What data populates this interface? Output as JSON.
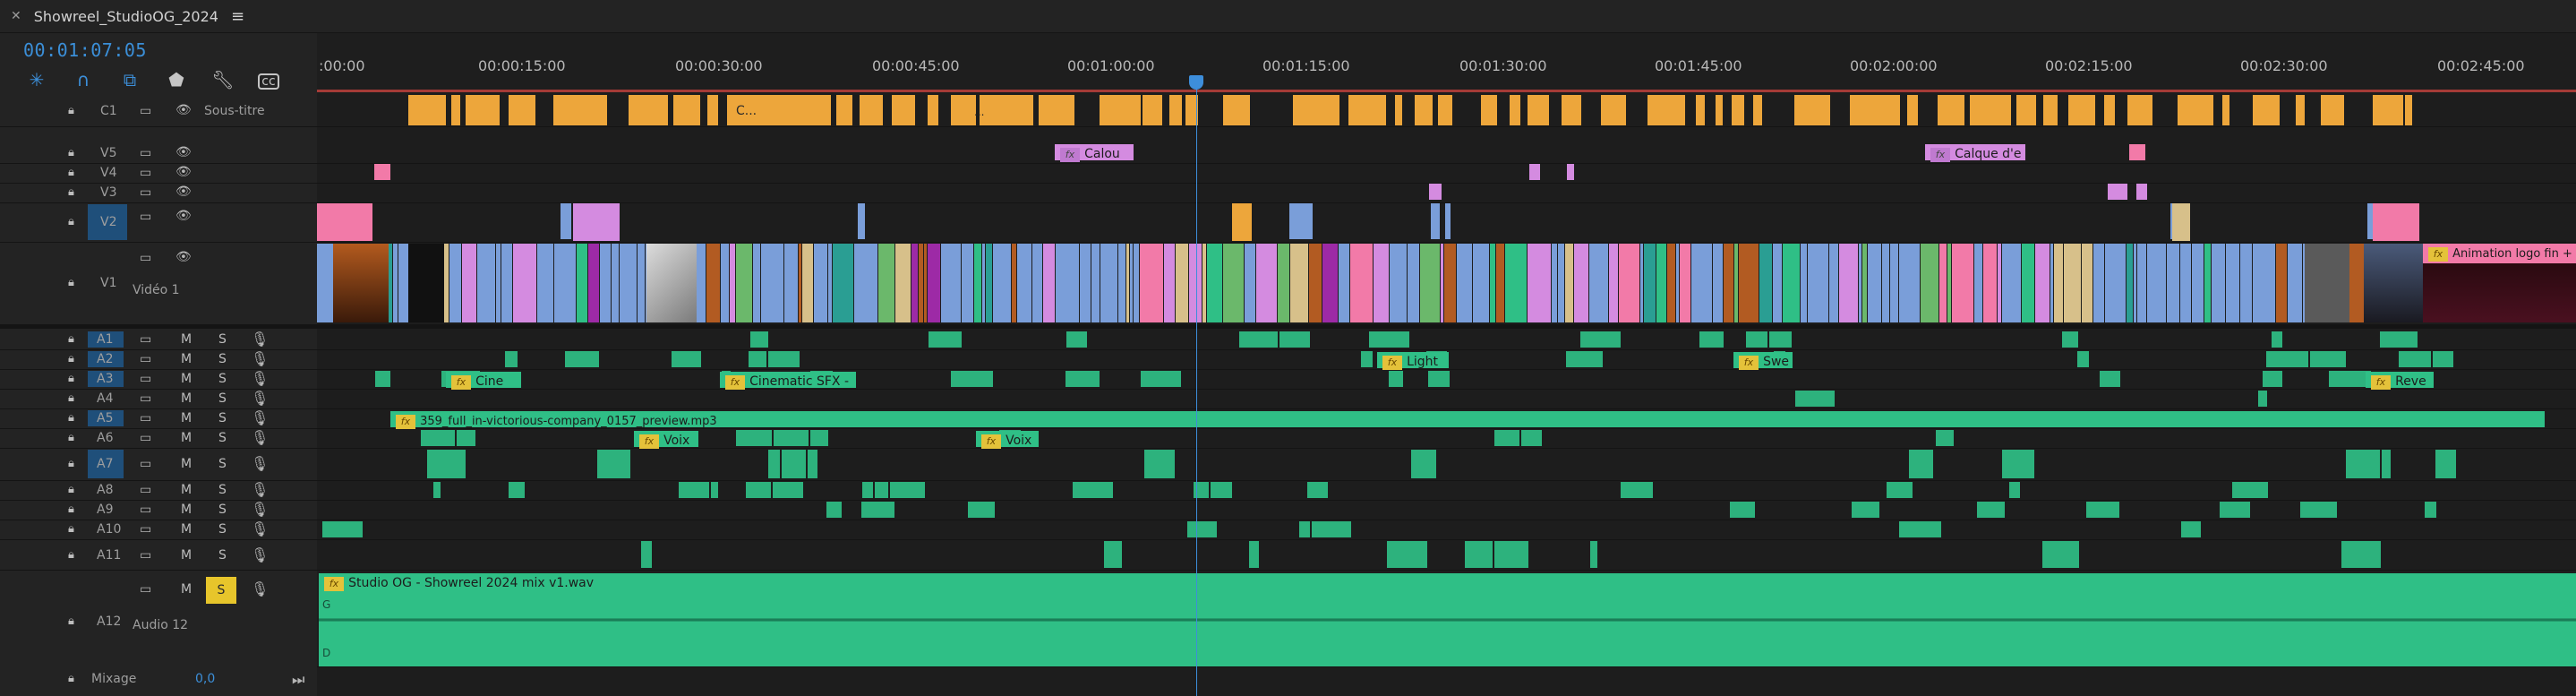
{
  "sequence": {
    "name": "Showreel_StudioOG_2024",
    "timecode": "00:01:07:05"
  },
  "icons": {
    "close": "close-icon",
    "menu": "hamburger-menu-icon",
    "snap": "snap-icon",
    "link": "linked-selection-icon",
    "marker": "add-marker-icon",
    "wrench": "settings-wrench-icon",
    "captions": "captions-icon"
  },
  "ruler": {
    "ticks": [
      ":00:00",
      "00:00:15:00",
      "00:00:30:00",
      "00:00:45:00",
      "00:01:00:00",
      "00:01:15:00",
      "00:01:30:00",
      "00:01:45:00",
      "00:02:00:00",
      "00:02:15:00",
      "00:02:30:00",
      "00:02:45:00"
    ]
  },
  "caption_track": {
    "name": "C1",
    "label": "Sous-titre",
    "clip_labels": [
      "C...",
      "..."
    ]
  },
  "video_tracks": [
    {
      "id": "V5",
      "name": ""
    },
    {
      "id": "V4",
      "name": ""
    },
    {
      "id": "V3",
      "name": ""
    },
    {
      "id": "V2",
      "name": ""
    },
    {
      "id": "V1",
      "name": "Vidéo 1"
    }
  ],
  "audio_tracks": [
    {
      "id": "A1"
    },
    {
      "id": "A2"
    },
    {
      "id": "A3"
    },
    {
      "id": "A4"
    },
    {
      "id": "A5"
    },
    {
      "id": "A6"
    },
    {
      "id": "A7"
    },
    {
      "id": "A8"
    },
    {
      "id": "A9"
    },
    {
      "id": "A10"
    },
    {
      "id": "A11"
    },
    {
      "id": "A12",
      "name": "Audio 12"
    }
  ],
  "track_controls": {
    "mute": "M",
    "solo": "S"
  },
  "clips": {
    "v5_calou": "Calou",
    "v5_calque": "Calque d'e",
    "v1_animation": "Animation logo fin +",
    "a2_light": "Light",
    "a2_swe": "Swe",
    "a3_cine": "Cine",
    "a3_cinematic": "Cinematic SFX -",
    "a3_reve": "Reve",
    "a5_long": "359_full_in-victorious-company_0157_preview.mp3",
    "a6_voix1": "Voix",
    "a6_voix2": "Voix",
    "a12_mix": "Studio OG - Showreel 2024 mix v1.wav",
    "a12_channel_g": "G",
    "a12_channel_d": "D"
  },
  "mix": {
    "label": "Mixage",
    "value": "0,0"
  },
  "colors": {
    "accent_blue": "#3d8edb",
    "caption_orange": "#eda63b",
    "video_blue": "#7a9ed9",
    "audio_green": "#2fbf86",
    "pink": "#f27aa8",
    "lavender": "#d48be0",
    "solo_yellow": "#e7c52b"
  }
}
